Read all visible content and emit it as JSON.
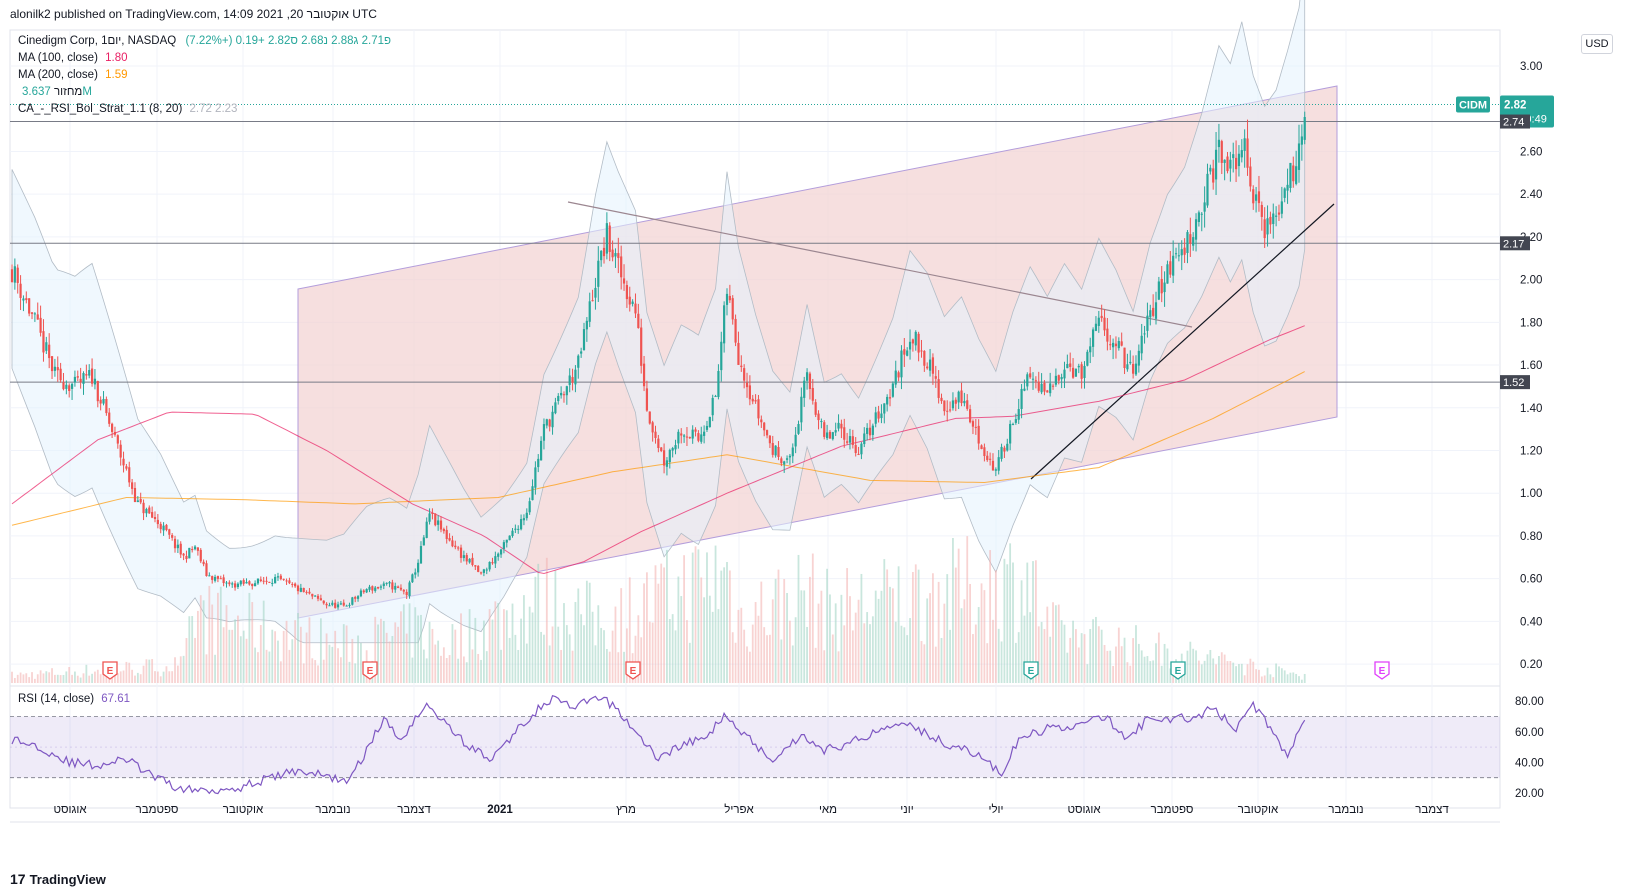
{
  "header": {
    "published": "alonilk2 published on TradingView.com, 14:09 2021 ,20 אוקטובר UTC"
  },
  "legend": {
    "symbol": "Cinedigm Corp, 1יום, NASDAQ",
    "ohlc": "פ2.71  ג2.88  נ2.68  ס2.82  +0.19 (+7.22%)",
    "ma100_label": "MA (100, close)",
    "ma100_value": "1.80",
    "ma200_label": "MA (200, close)",
    "ma200_value": "1.59",
    "volume_label": "מחזור",
    "volume_value": "3.637M",
    "strategy_label": "CA_-_RSI_Bol_Strat_1.1 (8, 20)",
    "strategy_value": "2.72  2.23",
    "rsi_label": "RSI (14, close)",
    "rsi_value": "67.61"
  },
  "currency_button": "USD",
  "footer": {
    "logo": "17",
    "brand": "TradingView"
  },
  "colors": {
    "up": "#26a69a",
    "down": "#ef5350",
    "ma100": "#e91e63",
    "ma200": "#ff9800",
    "rsi": "#7e57c2",
    "channel_fill": "#f3d4d4",
    "bollinger_fill": "#e3f2fd",
    "price_tag": "#26a69a",
    "hline_tag": "#434651"
  },
  "chart_data": [
    {
      "type": "candlestick",
      "symbol": "CIDM",
      "exchange": "NASDAQ",
      "interval": "1D",
      "ylim": [
        0.1,
        3.1
      ],
      "y_ticks": [
        3.0,
        2.6,
        2.4,
        2.2,
        2.0,
        1.8,
        1.6,
        1.4,
        1.2,
        1.0,
        0.8,
        0.6,
        0.4,
        0.2
      ],
      "x_labels": [
        "אוגוסט",
        "ספטמבר",
        "אוקטובר",
        "נובמבר",
        "דצמבר",
        "2021",
        "מרץ",
        "אפריל",
        "מאי",
        "יוני",
        "יולי",
        "אוגוסט",
        "ספטמבר",
        "אוקטובר",
        "נובמבר",
        "דצמבר"
      ],
      "last_price": {
        "label": "CIDM",
        "value": "2.82",
        "countdown": "05:50:49"
      },
      "horizontal_levels": [
        "2.74",
        "2.17",
        "1.52"
      ],
      "price_waypoints": [
        [
          0,
          2.05
        ],
        [
          8,
          1.8
        ],
        [
          15,
          1.55
        ],
        [
          22,
          1.5
        ],
        [
          28,
          1.55
        ],
        [
          36,
          1.25
        ],
        [
          44,
          0.95
        ],
        [
          52,
          0.85
        ],
        [
          60,
          0.7
        ],
        [
          64,
          0.75
        ],
        [
          68,
          0.62
        ],
        [
          76,
          0.57
        ],
        [
          84,
          0.58
        ],
        [
          92,
          0.6
        ],
        [
          100,
          0.55
        ],
        [
          110,
          0.48
        ],
        [
          116,
          0.47
        ],
        [
          124,
          0.55
        ],
        [
          132,
          0.57
        ],
        [
          138,
          0.53
        ],
        [
          142,
          0.68
        ],
        [
          146,
          0.9
        ],
        [
          150,
          0.83
        ],
        [
          158,
          0.7
        ],
        [
          164,
          0.62
        ],
        [
          172,
          0.75
        ],
        [
          180,
          0.92
        ],
        [
          186,
          1.3
        ],
        [
          192,
          1.45
        ],
        [
          198,
          1.6
        ],
        [
          204,
          2.0
        ],
        [
          208,
          2.2
        ],
        [
          212,
          2.05
        ],
        [
          218,
          1.85
        ],
        [
          222,
          1.4
        ],
        [
          228,
          1.15
        ],
        [
          234,
          1.3
        ],
        [
          240,
          1.25
        ],
        [
          246,
          1.45
        ],
        [
          250,
          1.95
        ],
        [
          254,
          1.65
        ],
        [
          260,
          1.4
        ],
        [
          266,
          1.2
        ],
        [
          272,
          1.15
        ],
        [
          278,
          1.55
        ],
        [
          284,
          1.25
        ],
        [
          290,
          1.3
        ],
        [
          296,
          1.2
        ],
        [
          302,
          1.35
        ],
        [
          308,
          1.5
        ],
        [
          314,
          1.75
        ],
        [
          320,
          1.62
        ],
        [
          326,
          1.4
        ],
        [
          332,
          1.45
        ],
        [
          338,
          1.25
        ],
        [
          344,
          1.1
        ],
        [
          350,
          1.35
        ],
        [
          356,
          1.55
        ],
        [
          362,
          1.45
        ],
        [
          368,
          1.62
        ],
        [
          374,
          1.55
        ],
        [
          380,
          1.8
        ],
        [
          386,
          1.7
        ],
        [
          392,
          1.55
        ],
        [
          398,
          1.85
        ],
        [
          404,
          2.05
        ],
        [
          410,
          2.15
        ],
        [
          416,
          2.35
        ],
        [
          422,
          2.6
        ],
        [
          426,
          2.5
        ],
        [
          430,
          2.65
        ],
        [
          434,
          2.4
        ],
        [
          438,
          2.25
        ],
        [
          442,
          2.3
        ],
        [
          446,
          2.45
        ],
        [
          450,
          2.62
        ],
        [
          452,
          2.82
        ]
      ],
      "ma100": [
        [
          0,
          0.95
        ],
        [
          30,
          1.25
        ],
        [
          55,
          1.38
        ],
        [
          85,
          1.37
        ],
        [
          110,
          1.2
        ],
        [
          140,
          0.95
        ],
        [
          165,
          0.8
        ],
        [
          185,
          0.62
        ],
        [
          200,
          0.68
        ],
        [
          220,
          0.82
        ],
        [
          250,
          1.0
        ],
        [
          290,
          1.22
        ],
        [
          330,
          1.35
        ],
        [
          350,
          1.36
        ],
        [
          380,
          1.43
        ],
        [
          410,
          1.53
        ],
        [
          440,
          1.72
        ],
        [
          455,
          1.8
        ]
      ],
      "ma200": [
        [
          0,
          0.85
        ],
        [
          40,
          0.98
        ],
        [
          80,
          0.97
        ],
        [
          120,
          0.95
        ],
        [
          170,
          0.98
        ],
        [
          210,
          1.1
        ],
        [
          250,
          1.18
        ],
        [
          300,
          1.06
        ],
        [
          340,
          1.05
        ],
        [
          380,
          1.12
        ],
        [
          420,
          1.35
        ],
        [
          455,
          1.59
        ]
      ],
      "volume": [
        [
          0,
          0.05
        ],
        [
          60,
          0.12
        ],
        [
          64,
          0.45
        ],
        [
          116,
          0.25
        ],
        [
          142,
          0.35
        ],
        [
          150,
          0.25
        ],
        [
          186,
          0.55
        ],
        [
          206,
          0.4
        ],
        [
          250,
          0.72
        ],
        [
          254,
          0.42
        ],
        [
          278,
          0.6
        ],
        [
          284,
          0.48
        ],
        [
          356,
          0.68
        ],
        [
          362,
          0.35
        ],
        [
          452,
          0.05
        ]
      ],
      "events": [
        {
          "label": "E",
          "type": "earnings-past"
        },
        {
          "label": "E",
          "type": "earnings-past"
        },
        {
          "label": "E",
          "type": "earnings-past"
        },
        {
          "label": "E",
          "type": "earnings"
        },
        {
          "label": "E",
          "type": "earnings"
        },
        {
          "label": "E",
          "type": "earnings-future"
        }
      ]
    },
    {
      "type": "line",
      "name": "RSI (14, close)",
      "ylim": [
        15,
        88
      ],
      "y_ticks": [
        80.0,
        60.0,
        40.0,
        20.0
      ],
      "bands": [
        70,
        30
      ],
      "rsi_waypoints": [
        [
          0,
          55
        ],
        [
          10,
          50
        ],
        [
          20,
          40
        ],
        [
          30,
          38
        ],
        [
          40,
          42
        ],
        [
          50,
          30
        ],
        [
          60,
          22
        ],
        [
          70,
          22
        ],
        [
          80,
          24
        ],
        [
          100,
          35
        ],
        [
          112,
          30
        ],
        [
          118,
          28
        ],
        [
          126,
          55
        ],
        [
          130,
          68
        ],
        [
          136,
          55
        ],
        [
          142,
          72
        ],
        [
          146,
          78
        ],
        [
          150,
          68
        ],
        [
          160,
          50
        ],
        [
          168,
          42
        ],
        [
          176,
          60
        ],
        [
          184,
          75
        ],
        [
          190,
          82
        ],
        [
          196,
          75
        ],
        [
          204,
          82
        ],
        [
          210,
          78
        ],
        [
          218,
          60
        ],
        [
          226,
          42
        ],
        [
          234,
          52
        ],
        [
          242,
          55
        ],
        [
          250,
          72
        ],
        [
          256,
          58
        ],
        [
          266,
          42
        ],
        [
          276,
          58
        ],
        [
          284,
          48
        ],
        [
          292,
          52
        ],
        [
          302,
          60
        ],
        [
          312,
          68
        ],
        [
          320,
          58
        ],
        [
          330,
          50
        ],
        [
          338,
          45
        ],
        [
          346,
          32
        ],
        [
          352,
          55
        ],
        [
          362,
          62
        ],
        [
          372,
          64
        ],
        [
          382,
          70
        ],
        [
          390,
          55
        ],
        [
          398,
          70
        ],
        [
          406,
          68
        ],
        [
          414,
          70
        ],
        [
          420,
          75
        ],
        [
          428,
          62
        ],
        [
          434,
          78
        ],
        [
          440,
          62
        ],
        [
          446,
          45
        ],
        [
          452,
          67.61
        ]
      ]
    }
  ]
}
